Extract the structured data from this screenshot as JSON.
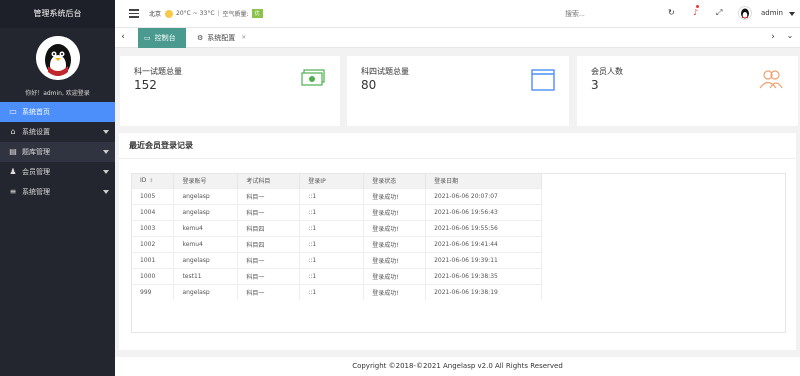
{
  "sidebar": {
    "title": "管理系统后台",
    "welcome": "你好！admin, 欢迎登录",
    "items": [
      {
        "label": "系统首页",
        "icon": "monitor-icon"
      },
      {
        "label": "系统设置",
        "icon": "home-icon"
      },
      {
        "label": "题库管理",
        "icon": "book-icon"
      },
      {
        "label": "会员管理",
        "icon": "users-icon"
      },
      {
        "label": "系统管理",
        "icon": "list-icon"
      }
    ]
  },
  "header": {
    "city": "北京",
    "temperature": "20°C ~ 33°C",
    "air_quality_label": "空气质量:",
    "air_quality_value": "优",
    "search_placeholder": "搜索...",
    "user": "admin"
  },
  "tabs": [
    {
      "label": "控制台"
    },
    {
      "label": "系统配置"
    }
  ],
  "cards": [
    {
      "label": "科一试题总量",
      "value": "152",
      "icon": "money-icon"
    },
    {
      "label": "科四试题总量",
      "value": "80",
      "icon": "browser-window-icon"
    },
    {
      "label": "会员人数",
      "value": "3",
      "icon": "users-icon"
    }
  ],
  "records": {
    "title": "最近会员登录记录",
    "columns": [
      "ID",
      "登录账号",
      "考试科目",
      "登录IP",
      "登录状态",
      "登录日期"
    ],
    "rows": [
      [
        "1005",
        "angelasp",
        "科目一",
        "::1",
        "登录成功!",
        "2021-06-06 20:07:07"
      ],
      [
        "1004",
        "angelasp",
        "科目一",
        "::1",
        "登录成功!",
        "2021-06-06 19:56:43"
      ],
      [
        "1003",
        "kemu4",
        "科目四",
        "::1",
        "登录成功!",
        "2021-06-06 19:55:56"
      ],
      [
        "1002",
        "kemu4",
        "科目四",
        "::1",
        "登录成功!",
        "2021-06-06 19:41:44"
      ],
      [
        "1001",
        "angelasp",
        "科目一",
        "::1",
        "登录成功!",
        "2021-06-06 19:39:11"
      ],
      [
        "1000",
        "test11",
        "科目一",
        "::1",
        "登录成功!",
        "2021-06-06 19:38:35"
      ],
      [
        "999",
        "angelasp",
        "科目一",
        "::1",
        "登录成功!",
        "2021-06-06 19:38:19"
      ]
    ]
  },
  "footer": "Copyright ©2018-©2021 Angelasp v2.0 All Rights Reserved",
  "colors": {
    "sidebar": "#23262e",
    "active": "#4c8ffb",
    "tab_active": "#4a9a8f",
    "card_icon": "#4caf50"
  }
}
